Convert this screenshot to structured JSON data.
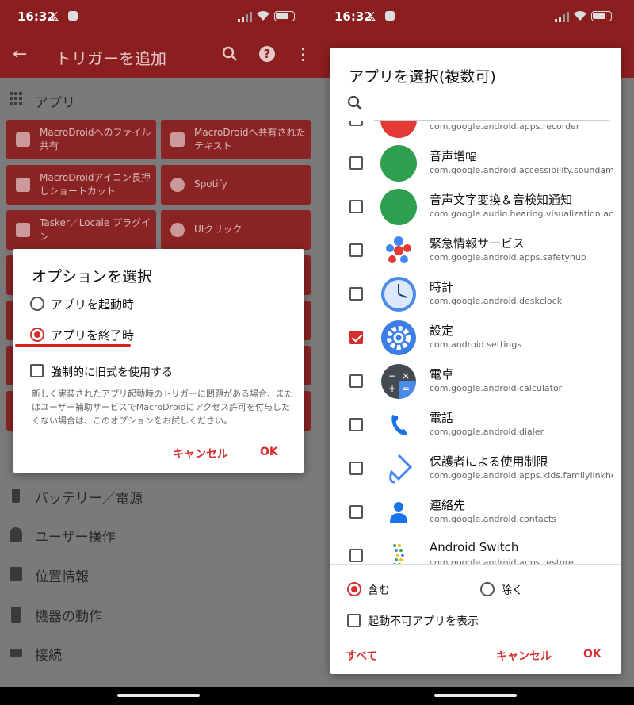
{
  "left": {
    "status": {
      "time": "16:32",
      "x_glyph": "𝕏"
    },
    "appbar": {
      "title": "トリガーを追加"
    },
    "section": {
      "label": "アプリ"
    },
    "tiles": [
      {
        "label": "MacroDroidへのファイル共有"
      },
      {
        "label": "MacroDroidへ共有されたテキスト"
      },
      {
        "label": "MacroDroidアイコン長押しショートカット"
      },
      {
        "label": "Spotify"
      },
      {
        "label": "Tasker／Locale プラグイン"
      },
      {
        "label": "UIクリック"
      }
    ],
    "categories": [
      {
        "label": "バッテリー／電源",
        "icon": "plug-icon"
      },
      {
        "label": "ユーザー操作",
        "icon": "person-icon"
      },
      {
        "label": "位置情報",
        "icon": "map-icon"
      },
      {
        "label": "機器の動作",
        "icon": "phone-icon"
      },
      {
        "label": "接続",
        "icon": "router-icon"
      }
    ],
    "dialog": {
      "title": "オプションを選択",
      "option_launch": "アプリを起動時",
      "option_exit": "アプリを終了時",
      "selected": "exit",
      "force_legacy": "強制的に旧式を使用する",
      "description": "新しく実装されたアプリ起動時のトリガーに問題がある場合、またはユーザー補助サービスでMacroDroidにアクセス許可を付与したくない場合は、このオプションをお試しください。",
      "cancel": "キャンセル",
      "ok": "OK"
    }
  },
  "right": {
    "status": {
      "time": "16:32",
      "x_glyph": "𝕏"
    },
    "dialog": {
      "title": "アプリを選択(複数可)",
      "search_placeholder": "",
      "apps": [
        {
          "name": "",
          "pkg": "com.google.android.apps.recorder",
          "checked": false,
          "color": "#e53935",
          "icon": "recorder-icon"
        },
        {
          "name": "音声増幅",
          "pkg": "com.google.android.accessibility.soundamplifier",
          "checked": false,
          "color": "#2e9e4f",
          "icon": "ear-icon"
        },
        {
          "name": "音声文字変換＆音検知通知",
          "pkg": "com.google.audio.hearing.visualization.accessibility.scribe",
          "checked": false,
          "color": "#2e9e4f",
          "icon": "transcribe-icon"
        },
        {
          "name": "緊急情報サービス",
          "pkg": "com.google.android.apps.safetyhub",
          "checked": false,
          "color": "#ffffff",
          "icon": "safety-icon"
        },
        {
          "name": "時計",
          "pkg": "com.google.android.deskclock",
          "checked": false,
          "color": "#4a8ae8",
          "icon": "clock-icon"
        },
        {
          "name": "設定",
          "pkg": "com.android.settings",
          "checked": true,
          "color": "#3d7de6",
          "icon": "settings-gear-icon"
        },
        {
          "name": "電卓",
          "pkg": "com.google.android.calculator",
          "checked": false,
          "color": "#444a52",
          "icon": "calculator-icon"
        },
        {
          "name": "電話",
          "pkg": "com.google.android.dialer",
          "checked": false,
          "color": "#ffffff",
          "icon": "dialer-icon"
        },
        {
          "name": "保護者による使用制限",
          "pkg": "com.google.android.apps.kids.familylinkhelper",
          "checked": false,
          "color": "#ffffff",
          "icon": "family-link-icon"
        },
        {
          "name": "連絡先",
          "pkg": "com.google.android.contacts",
          "checked": false,
          "color": "#ffffff",
          "icon": "contacts-icon"
        },
        {
          "name": "Android Switch",
          "pkg": "com.google.android.apps.restore",
          "checked": false,
          "color": "#ffffff",
          "icon": "android-switch-icon"
        }
      ],
      "include": "含む",
      "exclude": "除く",
      "filter_selected": "include",
      "show_disabled": "起動不可アプリを表示",
      "all": "すべて",
      "cancel": "キャンセル",
      "ok": "OK"
    }
  }
}
